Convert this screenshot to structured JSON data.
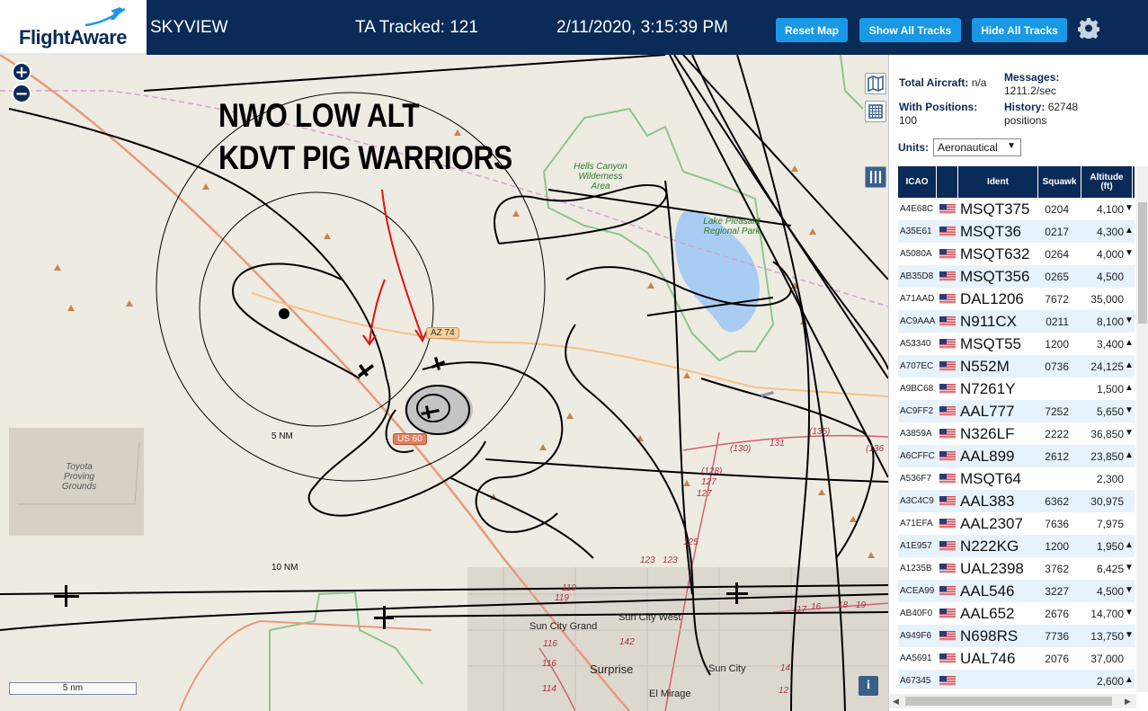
{
  "header": {
    "logo_text": "FlightAware",
    "app_name": "SKYVIEW",
    "tracked": "TA Tracked: 121",
    "datetime": "2/11/2020, 3:15:39 PM",
    "reset_map": "Reset Map",
    "show_all_tracks": "Show All Tracks",
    "hide_all_tracks": "Hide All Tracks"
  },
  "map": {
    "annotation_line1": "NWO LOW ALT",
    "annotation_line2": "KDVT PIG WARRIORS",
    "zoom_in": "+",
    "zoom_out": "−",
    "scale_label": "5 nm",
    "info": "i",
    "ring_5": "5 NM",
    "ring_10": "10 NM",
    "hwy_az74": "AZ 74",
    "hwy_us60": "US 60",
    "park_hells_canyon": "Hells Canyon Wilderness Area",
    "park_lake_pleasant": "Lake Pleasant Regional Park",
    "toyota": "Toyota Proving Grounds",
    "sun_city_grand": "Sun City Grand",
    "sun_city_west": "Sun City West",
    "surprise": "Surprise",
    "sun_city": "Sun City",
    "el_mirage": "El Mirage",
    "road_numbers": [
      "(130)",
      "131",
      "(135)",
      "(128)",
      "127",
      "127",
      "125",
      "123",
      "123",
      "119",
      "119",
      "116",
      "116",
      "114",
      "142",
      "17",
      "16",
      "18",
      "19",
      "14",
      "12",
      "(136"
    ],
    "colors": {
      "track": "#000000",
      "annotation_arrow": "#e01010",
      "land": "#eeebe3",
      "water": "#a9cdf2",
      "park_border": "#8ec48e"
    }
  },
  "panel": {
    "total_aircraft_label": "Total Aircraft:",
    "total_aircraft_value": "n/a",
    "messages_label": "Messages:",
    "messages_value": "1211.2/sec",
    "with_positions_label": "With Positions:",
    "with_positions_value": "100",
    "history_label": "History:",
    "history_value": "62748",
    "history_unit": "positions",
    "units_label": "Units:",
    "units_value": "Aeronautical",
    "columns": {
      "icao": "ICAO",
      "ident": "Ident",
      "squawk": "Squawk",
      "altitude": "Altitude",
      "altitude_unit": "(ft)"
    },
    "rows": [
      {
        "icao": "A4E68C",
        "ident": "MSQT375",
        "squawk": "0204",
        "alt": "4,100",
        "trend": "▼"
      },
      {
        "icao": "A35E61",
        "ident": "MSQT36",
        "squawk": "0217",
        "alt": "4,300",
        "trend": "▲"
      },
      {
        "icao": "A5080A",
        "ident": "MSQT632",
        "squawk": "0264",
        "alt": "4,000",
        "trend": "▼"
      },
      {
        "icao": "AB35D8",
        "ident": "MSQT356",
        "squawk": "0265",
        "alt": "4,500",
        "trend": ""
      },
      {
        "icao": "A71AAD",
        "ident": "DAL1206",
        "squawk": "7672",
        "alt": "35,000",
        "trend": ""
      },
      {
        "icao": "AC9AAA",
        "ident": "N911CX",
        "squawk": "0211",
        "alt": "8,100",
        "trend": "▼"
      },
      {
        "icao": "A53340",
        "ident": "MSQT55",
        "squawk": "1200",
        "alt": "3,400",
        "trend": "▲"
      },
      {
        "icao": "A707EC",
        "ident": "N552M",
        "squawk": "0736",
        "alt": "24,125",
        "trend": "▲"
      },
      {
        "icao": "A9BC68",
        "ident": "N7261Y",
        "squawk": "",
        "alt": "1,500",
        "trend": "▲"
      },
      {
        "icao": "AC9FF2",
        "ident": "AAL777",
        "squawk": "7252",
        "alt": "5,650",
        "trend": "▼"
      },
      {
        "icao": "A3859A",
        "ident": "N326LF",
        "squawk": "2222",
        "alt": "36,850",
        "trend": "▼"
      },
      {
        "icao": "A6CFFC",
        "ident": "AAL899",
        "squawk": "2612",
        "alt": "23,850",
        "trend": "▲"
      },
      {
        "icao": "A536F7",
        "ident": "MSQT64",
        "squawk": "",
        "alt": "2,300",
        "trend": ""
      },
      {
        "icao": "A3C4C9",
        "ident": "AAL383",
        "squawk": "6362",
        "alt": "30,975",
        "trend": ""
      },
      {
        "icao": "A71EFA",
        "ident": "AAL2307",
        "squawk": "7636",
        "alt": "7,975",
        "trend": ""
      },
      {
        "icao": "A1E957",
        "ident": "N222KG",
        "squawk": "1200",
        "alt": "1,950",
        "trend": "▲"
      },
      {
        "icao": "A1235B",
        "ident": "UAL2398",
        "squawk": "3762",
        "alt": "6,425",
        "trend": "▼"
      },
      {
        "icao": "ACEA99",
        "ident": "AAL546",
        "squawk": "3227",
        "alt": "4,500",
        "trend": "▼"
      },
      {
        "icao": "AB40F0",
        "ident": "AAL652",
        "squawk": "2676",
        "alt": "14,700",
        "trend": "▼"
      },
      {
        "icao": "A949F6",
        "ident": "N698RS",
        "squawk": "7736",
        "alt": "13,750",
        "trend": "▼"
      },
      {
        "icao": "AA5691",
        "ident": "UAL746",
        "squawk": "2076",
        "alt": "37,000",
        "trend": ""
      },
      {
        "icao": "A67345",
        "ident": "",
        "squawk": "",
        "alt": "2,600",
        "trend": "▲"
      }
    ]
  }
}
